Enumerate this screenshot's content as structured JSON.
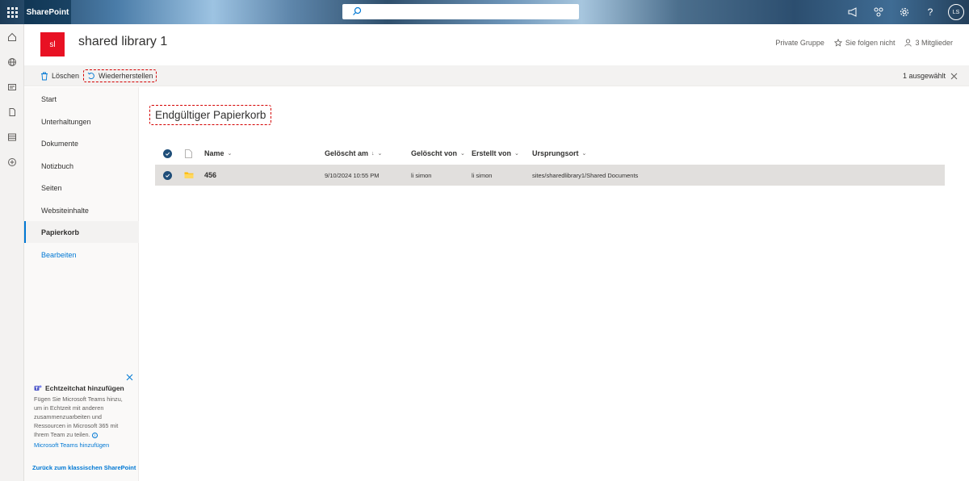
{
  "suite": {
    "brand": "SharePoint",
    "avatar_initials": "LS"
  },
  "site": {
    "logo_text": "sl",
    "title": "shared library 1",
    "group_type": "Private Gruppe",
    "follow_label": "Sie folgen nicht",
    "members_label": "3 Mitglieder"
  },
  "commandbar": {
    "delete_label": "Löschen",
    "restore_label": "Wiederherstellen",
    "selection_count": "1 ausgewählt"
  },
  "leftnav": {
    "items": [
      {
        "label": "Start"
      },
      {
        "label": "Unterhaltungen"
      },
      {
        "label": "Dokumente"
      },
      {
        "label": "Notizbuch"
      },
      {
        "label": "Seiten"
      },
      {
        "label": "Websiteinhalte"
      },
      {
        "label": "Papierkorb"
      },
      {
        "label": "Bearbeiten"
      }
    ],
    "promo": {
      "title": "Echtzeitchat hinzufügen",
      "body": "Fügen Sie Microsoft Teams hinzu, um in Echtzeit mit anderen zusammenzuarbeiten und Ressourcen in Microsoft 365 mit Ihrem Team zu teilen.",
      "link": "Microsoft Teams hinzufügen"
    },
    "classic_link": "Zurück zum klassischen SharePoint"
  },
  "main": {
    "heading": "Endgültiger Papierkorb",
    "columns": {
      "name": "Name",
      "deleted_on": "Gelöscht am",
      "deleted_by": "Gelöscht von",
      "created_by": "Erstellt von",
      "origin": "Ursprungsort"
    },
    "rows": [
      {
        "name": "456",
        "deleted_on": "9/10/2024 10:55 PM",
        "deleted_by": "li simon",
        "created_by": "li simon",
        "origin": "sites/sharedlibrary1/Shared Documents"
      }
    ]
  },
  "colors": {
    "accent": "#0078d4",
    "site_logo": "#e81123",
    "highlight_border": "#d40000",
    "check_fill": "#1f4e79",
    "folder": "#ffb900"
  }
}
